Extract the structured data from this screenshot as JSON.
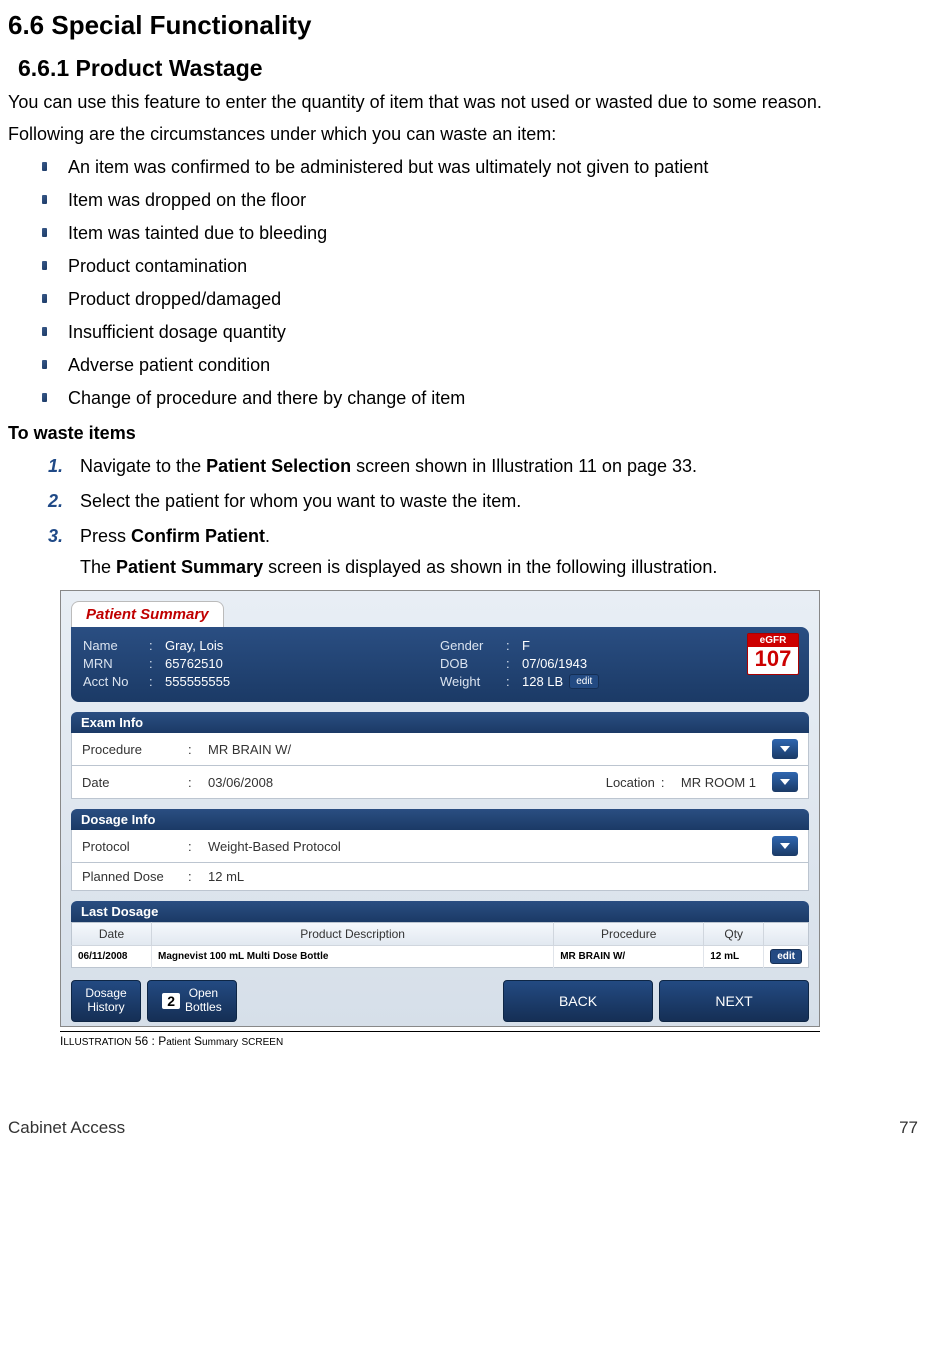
{
  "headings": {
    "h2": "6.6   Special Functionality",
    "h3": "6.6.1   Product Wastage"
  },
  "para1": "You can use this feature to enter the quantity of item that was not used or wasted due to some reason.",
  "para2": "Following are the circumstances under which you can waste an item:",
  "bullets": [
    "An item was confirmed to be administered but was ultimately not given to patient",
    "Item was dropped on the floor",
    "Item was tainted due to bleeding",
    "Product contamination",
    "Product dropped/damaged",
    "Insufficient dosage quantity",
    "Adverse patient condition",
    "Change of procedure and there by change of item"
  ],
  "to_waste_heading": "To waste items",
  "steps": {
    "s1_a": "Navigate to the ",
    "s1_b": "Patient Selection",
    "s1_c": " screen shown in Illustration 11 on page 33.",
    "s2": "Select the patient for whom you want to waste the item.",
    "s3_a": "Press ",
    "s3_b": "Confirm Patient",
    "s3_c": ".",
    "s3_sub_a": "The ",
    "s3_sub_b": "Patient Summary",
    "s3_sub_c": " screen is displayed as shown in the following illustration."
  },
  "screenshot": {
    "tab": "Patient Summary",
    "name_label": "Name",
    "name_value": "Gray, Lois",
    "mrn_label": "MRN",
    "mrn_value": "65762510",
    "acct_label": "Acct No",
    "acct_value": "555555555",
    "gender_label": "Gender",
    "gender_value": "F",
    "dob_label": "DOB",
    "dob_value": "07/06/1943",
    "weight_label": "Weight",
    "weight_value": "128 LB",
    "edit": "edit",
    "egfr_label": "eGFR",
    "egfr_value": "107",
    "exam_band": "Exam Info",
    "procedure_label": "Procedure",
    "procedure_value": "MR BRAIN W/",
    "date_label": "Date",
    "date_value": "03/06/2008",
    "location_label": "Location",
    "location_value": "MR ROOM 1",
    "dosage_band": "Dosage Info",
    "protocol_label": "Protocol",
    "protocol_value": "Weight-Based Protocol",
    "planned_label": "Planned Dose",
    "planned_value": "12 mL",
    "last_band": "Last Dosage",
    "col_date": "Date",
    "col_prod": "Product Description",
    "col_proc": "Procedure",
    "col_qty": "Qty",
    "row_date": "06/11/2008",
    "row_prod": "Magnevist 100 mL Multi Dose Bottle",
    "row_proc": "MR BRAIN W/",
    "row_qty": "12 mL",
    "btn_history": "Dosage\nHistory",
    "btn_open_num": "2",
    "btn_open": "Open\nBottles",
    "btn_back": "BACK",
    "btn_next": "NEXT"
  },
  "caption_a": "Illustration 56 : P",
  "caption_b": "atient",
  "caption_c": " S",
  "caption_d": "ummary",
  "caption_e": " screen",
  "footer_left": "Cabinet Access",
  "footer_right": "77"
}
